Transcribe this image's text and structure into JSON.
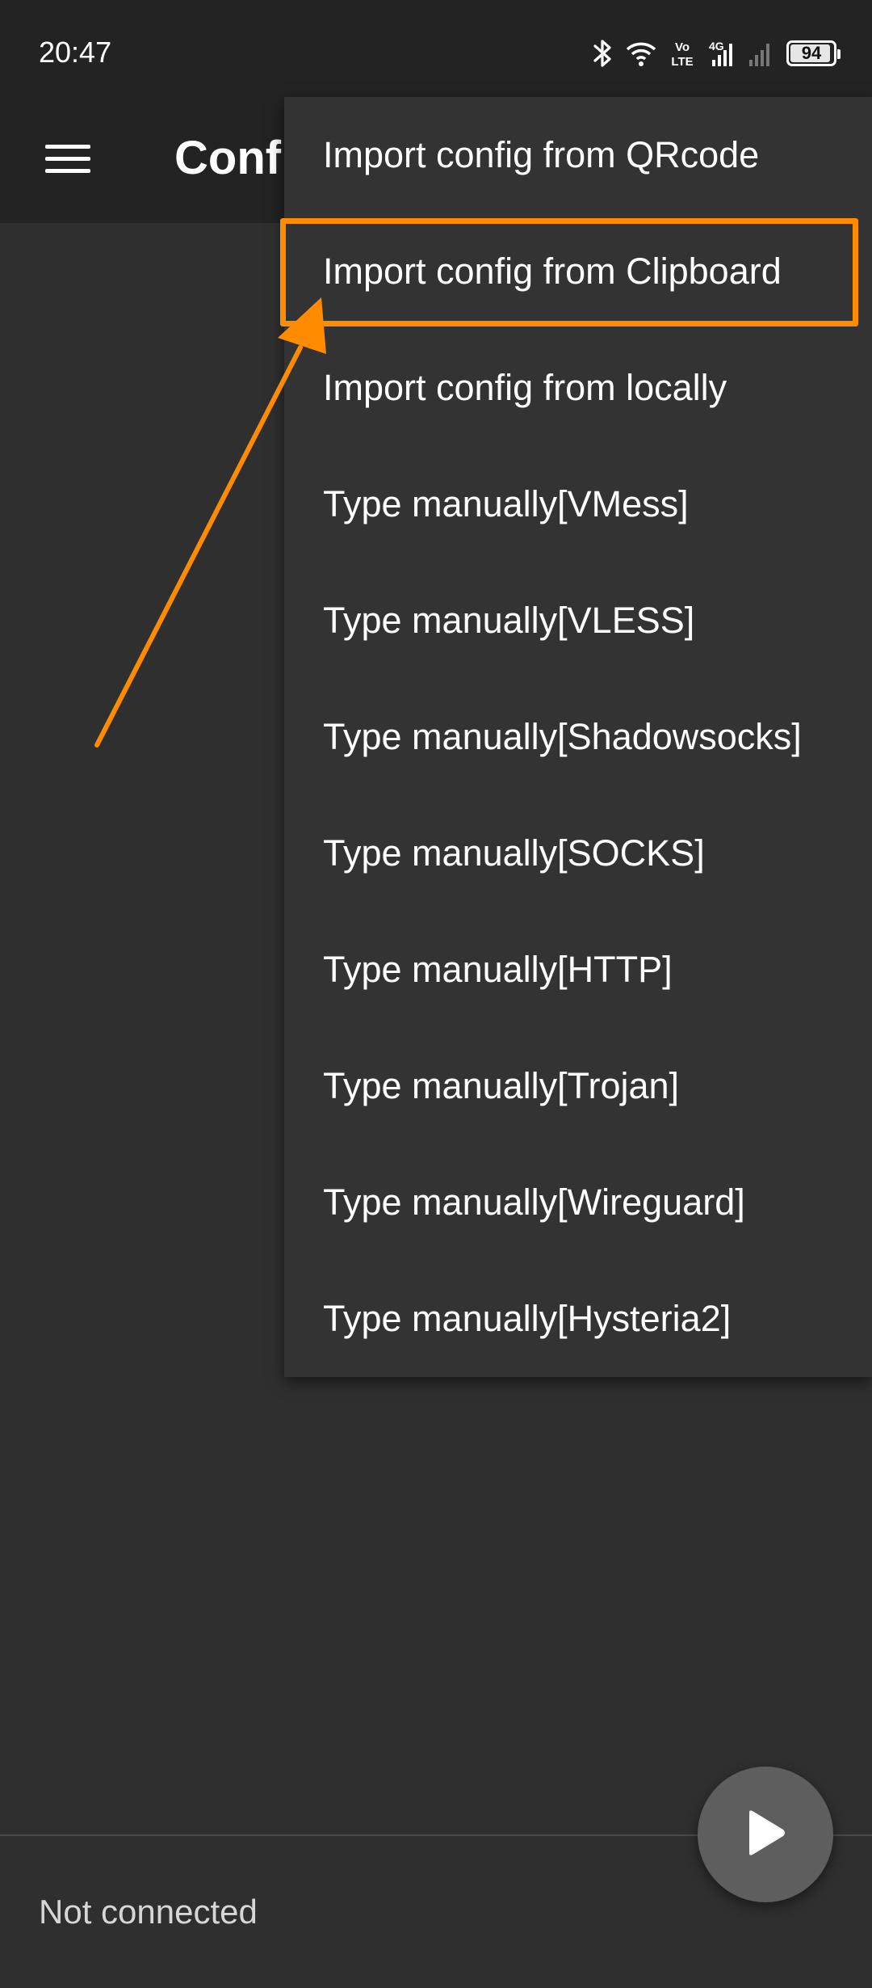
{
  "status_bar": {
    "time": "20:47",
    "battery_level": 94,
    "battery_label": "94",
    "icons": [
      "bluetooth-icon",
      "wifi-icon",
      "volte-icon",
      "4g-signal-icon",
      "signal-icon",
      "battery-icon"
    ],
    "volte_text_top": "Vo",
    "volte_text_bottom": "LTE",
    "network_type": "4G"
  },
  "app_bar": {
    "title": "Confi",
    "menu_icon": "hamburger-menu-icon"
  },
  "dropdown": {
    "items": [
      {
        "label": "Import config from QRcode"
      },
      {
        "label": "Import config from Clipboard"
      },
      {
        "label": "Import config from locally"
      },
      {
        "label": "Type manually[VMess]"
      },
      {
        "label": "Type manually[VLESS]"
      },
      {
        "label": "Type manually[Shadowsocks]"
      },
      {
        "label": "Type manually[SOCKS]"
      },
      {
        "label": "Type manually[HTTP]"
      },
      {
        "label": "Type manually[Trojan]"
      },
      {
        "label": "Type manually[Wireguard]"
      },
      {
        "label": "Type manually[Hysteria2]"
      }
    ],
    "highlighted_item": "Import config from Clipboard"
  },
  "annotation": {
    "color": "#ff8c00"
  },
  "bottom": {
    "status": "Not connected",
    "fab_icon": "play-icon"
  },
  "colors": {
    "background": "#2f2f2f",
    "app_bar": "#232323",
    "menu": "#333333",
    "accent": "#ff8c00"
  }
}
